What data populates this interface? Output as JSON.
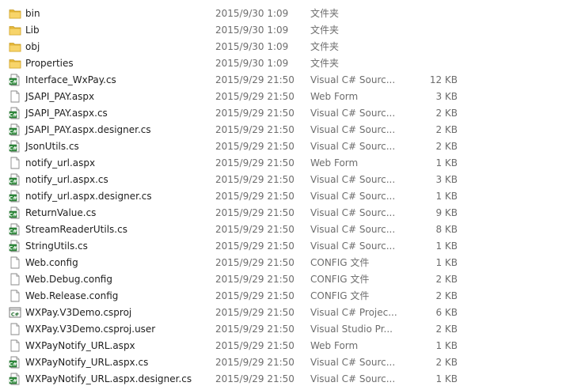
{
  "files": [
    {
      "name": "bin",
      "date": "2015/9/30 1:09",
      "type": "文件夹",
      "size": "",
      "icon": "folder-icon"
    },
    {
      "name": "Lib",
      "date": "2015/9/30 1:09",
      "type": "文件夹",
      "size": "",
      "icon": "folder-icon"
    },
    {
      "name": "obj",
      "date": "2015/9/30 1:09",
      "type": "文件夹",
      "size": "",
      "icon": "folder-icon"
    },
    {
      "name": "Properties",
      "date": "2015/9/30 1:09",
      "type": "文件夹",
      "size": "",
      "icon": "folder-icon"
    },
    {
      "name": "Interface_WxPay.cs",
      "date": "2015/9/29 21:50",
      "type": "Visual C# Sourc...",
      "size": "12 KB",
      "icon": "csharp-file-icon"
    },
    {
      "name": "JSAPI_PAY.aspx",
      "date": "2015/9/29 21:50",
      "type": "Web Form",
      "size": "3 KB",
      "icon": "document-file-icon"
    },
    {
      "name": "JSAPI_PAY.aspx.cs",
      "date": "2015/9/29 21:50",
      "type": "Visual C# Sourc...",
      "size": "2 KB",
      "icon": "csharp-file-icon"
    },
    {
      "name": "JSAPI_PAY.aspx.designer.cs",
      "date": "2015/9/29 21:50",
      "type": "Visual C# Sourc...",
      "size": "2 KB",
      "icon": "csharp-file-icon"
    },
    {
      "name": "JsonUtils.cs",
      "date": "2015/9/29 21:50",
      "type": "Visual C# Sourc...",
      "size": "2 KB",
      "icon": "csharp-file-icon"
    },
    {
      "name": "notify_url.aspx",
      "date": "2015/9/29 21:50",
      "type": "Web Form",
      "size": "1 KB",
      "icon": "document-file-icon"
    },
    {
      "name": "notify_url.aspx.cs",
      "date": "2015/9/29 21:50",
      "type": "Visual C# Sourc...",
      "size": "3 KB",
      "icon": "csharp-file-icon"
    },
    {
      "name": "notify_url.aspx.designer.cs",
      "date": "2015/9/29 21:50",
      "type": "Visual C# Sourc...",
      "size": "1 KB",
      "icon": "csharp-file-icon"
    },
    {
      "name": "ReturnValue.cs",
      "date": "2015/9/29 21:50",
      "type": "Visual C# Sourc...",
      "size": "9 KB",
      "icon": "csharp-file-icon"
    },
    {
      "name": "StreamReaderUtils.cs",
      "date": "2015/9/29 21:50",
      "type": "Visual C# Sourc...",
      "size": "8 KB",
      "icon": "csharp-file-icon"
    },
    {
      "name": "StringUtils.cs",
      "date": "2015/9/29 21:50",
      "type": "Visual C# Sourc...",
      "size": "1 KB",
      "icon": "csharp-file-icon"
    },
    {
      "name": "Web.config",
      "date": "2015/9/29 21:50",
      "type": "CONFIG 文件",
      "size": "1 KB",
      "icon": "document-file-icon"
    },
    {
      "name": "Web.Debug.config",
      "date": "2015/9/29 21:50",
      "type": "CONFIG 文件",
      "size": "2 KB",
      "icon": "document-file-icon"
    },
    {
      "name": "Web.Release.config",
      "date": "2015/9/29 21:50",
      "type": "CONFIG 文件",
      "size": "2 KB",
      "icon": "document-file-icon"
    },
    {
      "name": "WXPay.V3Demo.csproj",
      "date": "2015/9/29 21:50",
      "type": "Visual C# Projec...",
      "size": "6 KB",
      "icon": "csproj-file-icon"
    },
    {
      "name": "WXPay.V3Demo.csproj.user",
      "date": "2015/9/29 21:50",
      "type": "Visual Studio Pr...",
      "size": "2 KB",
      "icon": "document-file-icon"
    },
    {
      "name": "WXPayNotify_URL.aspx",
      "date": "2015/9/29 21:50",
      "type": "Web Form",
      "size": "1 KB",
      "icon": "document-file-icon"
    },
    {
      "name": "WXPayNotify_URL.aspx.cs",
      "date": "2015/9/29 21:50",
      "type": "Visual C# Sourc...",
      "size": "2 KB",
      "icon": "csharp-file-icon"
    },
    {
      "name": "WXPayNotify_URL.aspx.designer.cs",
      "date": "2015/9/29 21:50",
      "type": "Visual C# Sourc...",
      "size": "1 KB",
      "icon": "csharp-file-icon"
    }
  ]
}
